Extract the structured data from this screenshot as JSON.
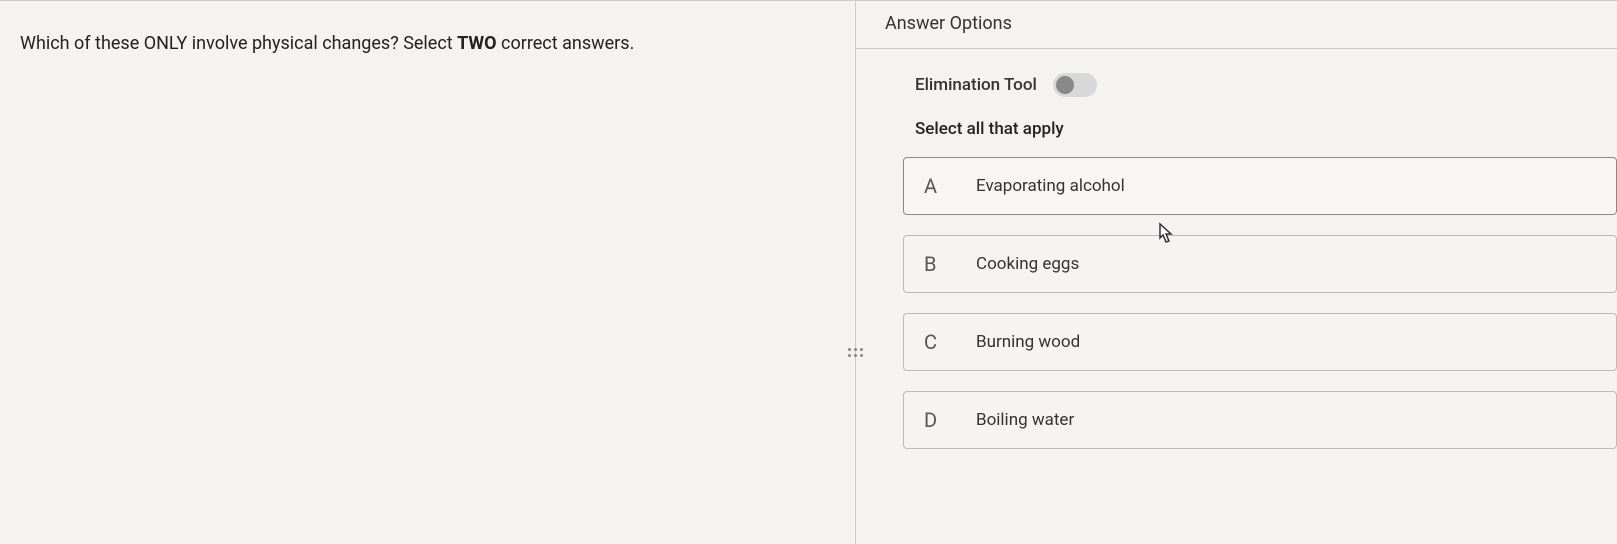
{
  "question": {
    "prefix": "Which of these ONLY involve physical changes? Select ",
    "emphasis": "TWO",
    "suffix": " correct answers."
  },
  "rightPanel": {
    "headerTitle": "Answer Options",
    "eliminationLabel": "Elimination Tool",
    "instruction": "Select all that apply",
    "options": [
      {
        "letter": "A",
        "text": "Evaporating alcohol"
      },
      {
        "letter": "B",
        "text": "Cooking eggs"
      },
      {
        "letter": "C",
        "text": "Burning wood"
      },
      {
        "letter": "D",
        "text": "Boiling water"
      }
    ]
  }
}
